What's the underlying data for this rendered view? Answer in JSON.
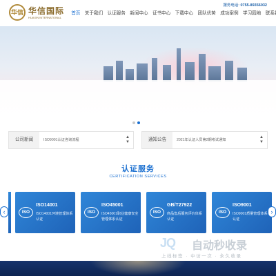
{
  "header": {
    "logo_mark": "华信",
    "logo_cn": "华信国际",
    "logo_en": "HUAXIN INTERNATIONAL",
    "hotline_label": "服务电话:",
    "hotline_number": "0755-89356032",
    "nav": [
      {
        "label": "首页",
        "active": true
      },
      {
        "label": "关于我们",
        "active": false
      },
      {
        "label": "认证服务",
        "active": false
      },
      {
        "label": "新闻中心",
        "active": false
      },
      {
        "label": "证书中心",
        "active": false
      },
      {
        "label": "下载中心",
        "active": false
      },
      {
        "label": "团队优势",
        "active": false
      },
      {
        "label": "成功案例",
        "active": false
      },
      {
        "label": "学习园地",
        "active": false
      },
      {
        "label": "联系我们",
        "active": false
      }
    ]
  },
  "banner": {
    "slide_count": 2,
    "active_slide": 1
  },
  "notices": [
    {
      "label": "公司新闻",
      "text": "ISO9001认证咨询流程"
    },
    {
      "label": "通知公告",
      "text": "2021年认证人员第2期考试通知"
    }
  ],
  "certification": {
    "title": "认证服务",
    "subtitle": "CERTIFICATION SERVICES",
    "cards": [
      {
        "badge": "ISO",
        "code": "ISO14001",
        "desc": "ISO14001环境管理体系认证"
      },
      {
        "badge": "ISO",
        "code": "ISO45001",
        "desc": "ISO45001职业健康安全管理体系认证"
      },
      {
        "badge": "ISO",
        "code": "GB/T27922",
        "desc": "商品售后服务评价体系认证"
      },
      {
        "badge": "ISO",
        "code": "ISO9001",
        "desc": "ISO9001质量管理体系认证"
      }
    ],
    "prev_label": "‹",
    "next_label": "›"
  },
  "watermark": {
    "logo": "JQ",
    "text": "自动秒收录",
    "slogan": "上线标签 · 中访一次 · 永久收录"
  },
  "colors": {
    "accent": "#1a6fd0",
    "card": "#2a7ad0",
    "footer": "#16336b",
    "brand_gold": "#8a6a2a"
  }
}
